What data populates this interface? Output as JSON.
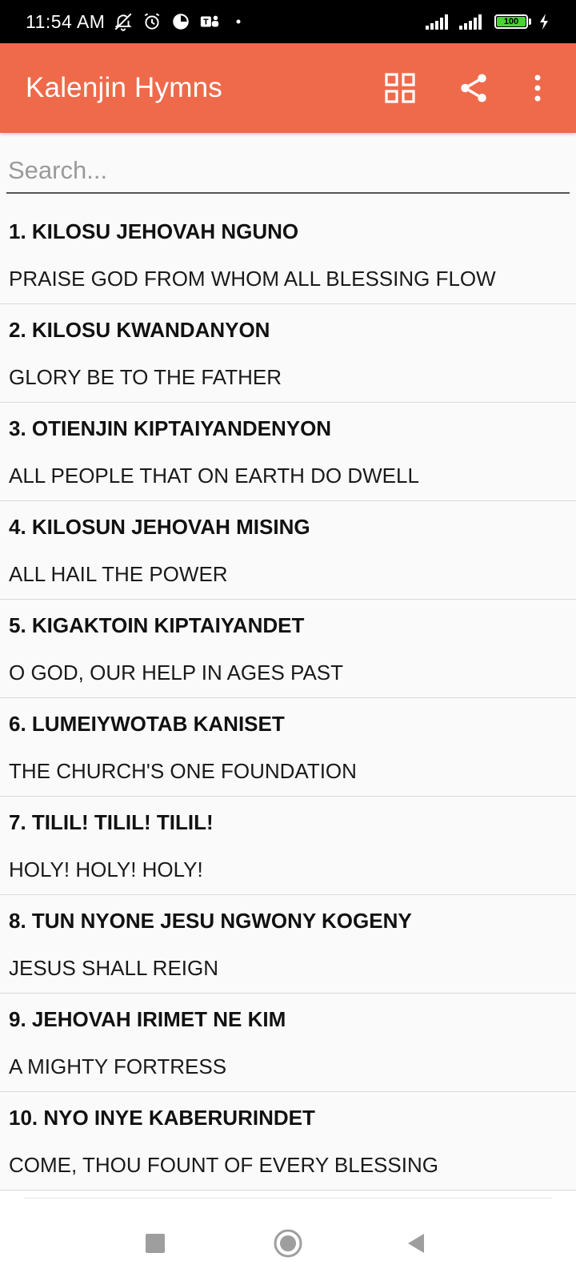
{
  "status_bar": {
    "time": "11:54 AM",
    "battery_level": "100",
    "left_icons": [
      "mute-icon",
      "alarm-icon",
      "data-saver-icon",
      "teams-icon",
      "dot-icon"
    ],
    "right_icons": [
      "signal-icon",
      "signal-icon",
      "battery-icon",
      "charging-icon"
    ]
  },
  "app_bar": {
    "title": "Kalenjin Hymns",
    "actions": [
      "grid-view-icon",
      "share-icon",
      "more-vert-icon"
    ]
  },
  "search": {
    "placeholder": "Search..."
  },
  "hymns": [
    {
      "title": "1. KILOSU JEHOVAH NGUNO",
      "subtitle": "PRAISE GOD FROM WHOM ALL BLESSING FLOW"
    },
    {
      "title": "2. KILOSU KWANDANYON",
      "subtitle": "GLORY BE TO THE FATHER"
    },
    {
      "title": "3. OTIENJIN KIPTAIYANDENYON",
      "subtitle": "ALL PEOPLE THAT ON EARTH DO DWELL"
    },
    {
      "title": "4. KILOSUN JEHOVAH MISING",
      "subtitle": "ALL HAIL THE POWER"
    },
    {
      "title": "5. KIGAKTOIN KIPTAIYANDET",
      "subtitle": "O GOD, OUR HELP IN AGES PAST"
    },
    {
      "title": "6. LUMEIYWOTAB KANISET",
      "subtitle": "THE CHURCH'S ONE FOUNDATION"
    },
    {
      "title": "7. TILIL! TILIL! TILIL!",
      "subtitle": "HOLY! HOLY! HOLY!"
    },
    {
      "title": "8. TUN NYONE JESU NGWONY KOGENY",
      "subtitle": "JESUS SHALL REIGN"
    },
    {
      "title": "9. JEHOVAH IRIMET NE KIM",
      "subtitle": "A MIGHTY FORTRESS"
    },
    {
      "title": "10. NYO INYE KABERURINDET",
      "subtitle": "COME, THOU FOUNT OF EVERY BLESSING"
    }
  ],
  "nav_bar": {
    "buttons": [
      "recents-icon",
      "home-icon",
      "back-icon"
    ]
  },
  "colors": {
    "accent": "#ee6a4b",
    "background": "#fafafa",
    "status_bar": "#000000",
    "battery": "#4cd137"
  }
}
